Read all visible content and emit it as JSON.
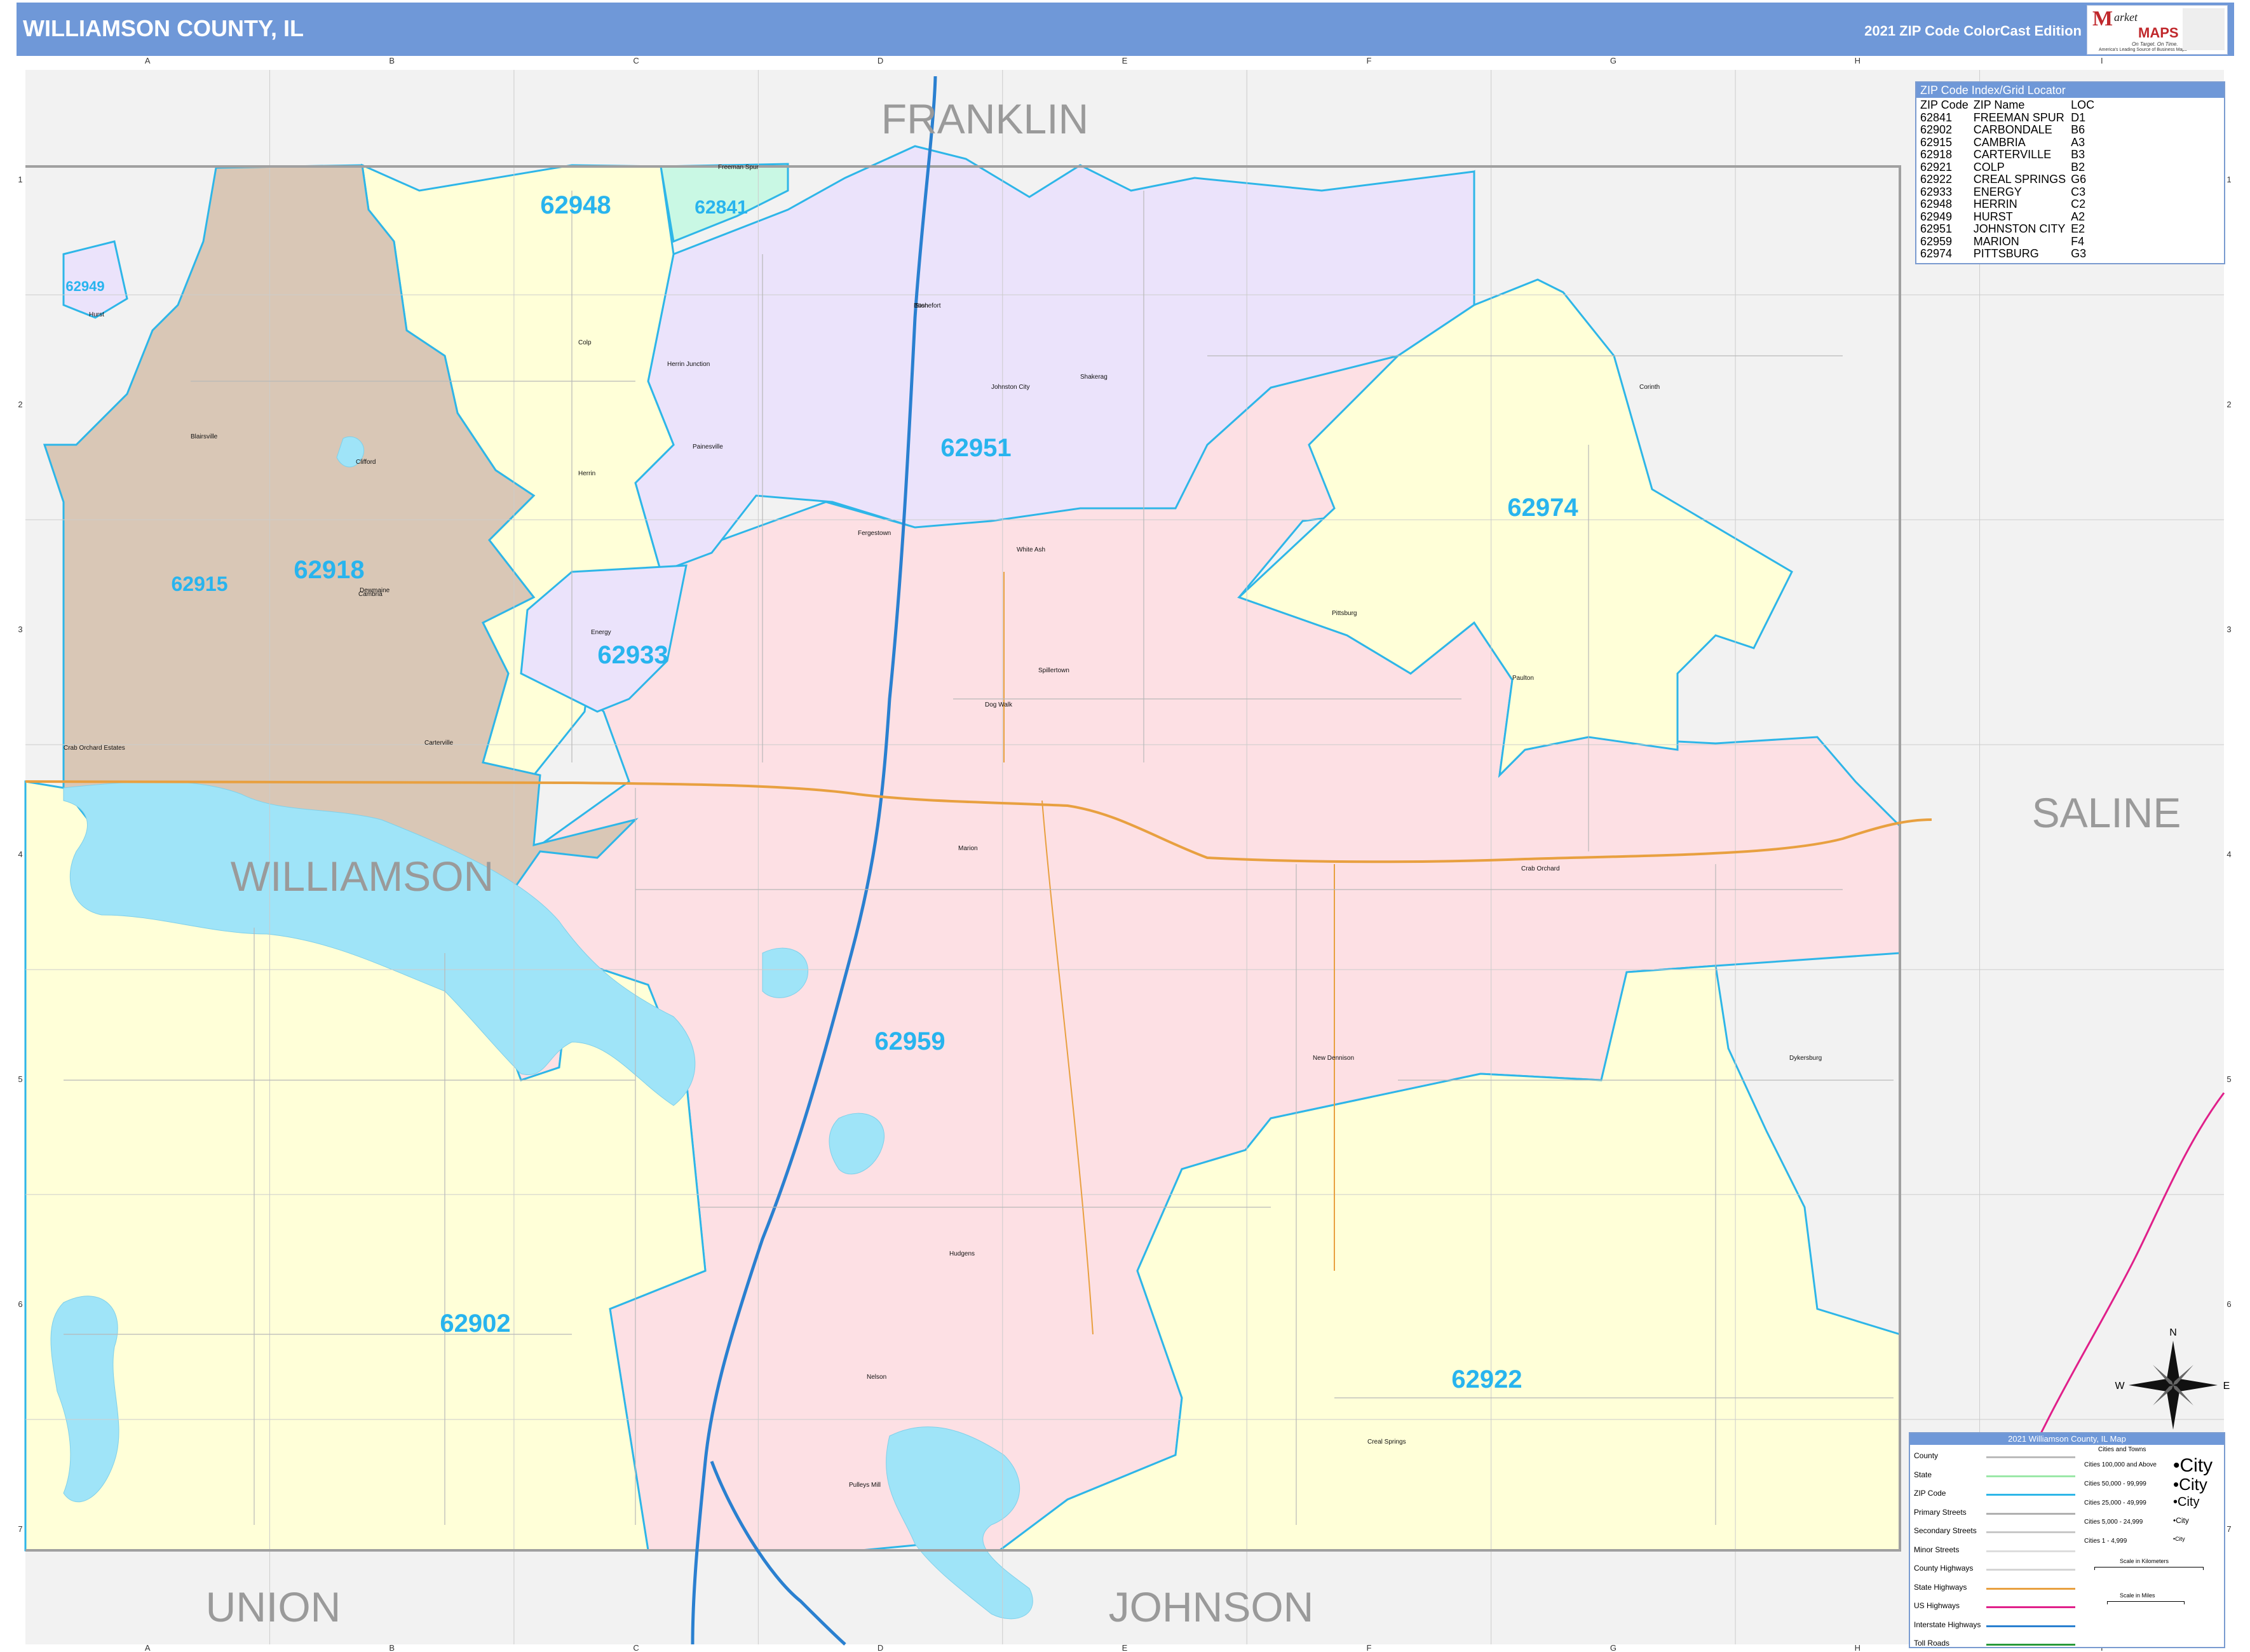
{
  "header": {
    "title": "WILLIAMSON COUNTY, IL",
    "edition": "2021 ZIP Code ColorCast Edition",
    "logo": {
      "mark": "M",
      "word": "arket",
      "maps": "MAPS",
      "tagline": "On Target. On Time.",
      "tagline2": "America's Leading Source of Business Maps"
    }
  },
  "colors": {
    "zip_62959": "#fde0e4",
    "zip_62902": "#ffffd8",
    "zip_62918": "#d9c7b6",
    "zip_62951": "#ebe3fb",
    "zip_62948": "#ffffd8",
    "zip_62841": "#c9f8e4",
    "water": "#9fe4f8",
    "outside": "#f2f2f2",
    "zip_border": "#2eb6e8",
    "interstate": "#2a80d0",
    "us_highway": "#e0208a",
    "state_highway": "#e8a040",
    "county_line": "#a0a0a0",
    "zip_label": "#28b4ee"
  },
  "grid": {
    "columns": [
      "A",
      "B",
      "C",
      "D",
      "E",
      "F",
      "G",
      "H",
      "I"
    ],
    "rows": [
      "1",
      "2",
      "3",
      "4",
      "5",
      "6",
      "7"
    ]
  },
  "counties": [
    "FRANKLIN",
    "SALINE",
    "WILLIAMSON",
    "UNION",
    "JOHNSON"
  ],
  "zip_labels": [
    "62948",
    "62841",
    "62949",
    "62951",
    "62918",
    "62915",
    "62933",
    "62974",
    "62959",
    "62902",
    "62922"
  ],
  "places": [
    "Freeman Spur",
    "Hurst",
    "Colp",
    "Herrin Junction",
    "Bush",
    "Johnston City",
    "Shakerag",
    "Blairsville",
    "Clifford",
    "Herrin",
    "Stonefort",
    "Painesville",
    "Fergestown",
    "White Ash",
    "Cambria",
    "Pittsburg",
    "Energy",
    "Spillertown",
    "Dewmaine",
    "Paulton",
    "Dog Walk",
    "Carterville",
    "Crab Orchard Estates",
    "Cambria",
    "Marion",
    "Crab Orchard",
    "New Dennison",
    "Hudgens",
    "Nelson",
    "Pulleys Mill",
    "Creal Springs",
    "Dykersburg",
    "Corinth"
  ],
  "compass": {
    "n": "N",
    "s": "S",
    "e": "E",
    "w": "W"
  },
  "zip_index": {
    "title": "ZIP Code Index/Grid Locator",
    "headers": [
      "ZIP Code",
      "ZIP Name",
      "LOC"
    ],
    "rows": [
      [
        "62841",
        "FREEMAN SPUR",
        "D1"
      ],
      [
        "62902",
        "CARBONDALE",
        "B6"
      ],
      [
        "62915",
        "CAMBRIA",
        "A3"
      ],
      [
        "62918",
        "CARTERVILLE",
        "B3"
      ],
      [
        "62921",
        "COLP",
        "B2"
      ],
      [
        "62922",
        "CREAL SPRINGS",
        "G6"
      ],
      [
        "62933",
        "ENERGY",
        "C3"
      ],
      [
        "62948",
        "HERRIN",
        "C2"
      ],
      [
        "62949",
        "HURST",
        "A2"
      ],
      [
        "62951",
        "JOHNSTON CITY",
        "E2"
      ],
      [
        "62959",
        "MARION",
        "F4"
      ],
      [
        "62974",
        "PITTSBURG",
        "G3"
      ]
    ]
  },
  "legend": {
    "title": "2021 Williamson County, IL Map",
    "items": [
      "County",
      "State",
      "ZIP Code",
      "Primary Streets",
      "Secondary Streets",
      "Minor Streets",
      "County Highways",
      "State Highways",
      "US Highways",
      "Interstate Highways",
      "Toll Roads"
    ],
    "cities_title": "Cities and Towns",
    "cities": [
      "Cities 100,000 and Above",
      "Cities 50,000 - 99,999",
      "Cities 25,000 - 49,999",
      "Cities 5,000 - 24,999",
      "Cities 1 - 4,999"
    ],
    "city_samples": [
      "City",
      "City",
      "City",
      "City",
      "City"
    ],
    "scale_km": "Scale in Kilometers",
    "scale_mi": "Scale in Miles"
  }
}
